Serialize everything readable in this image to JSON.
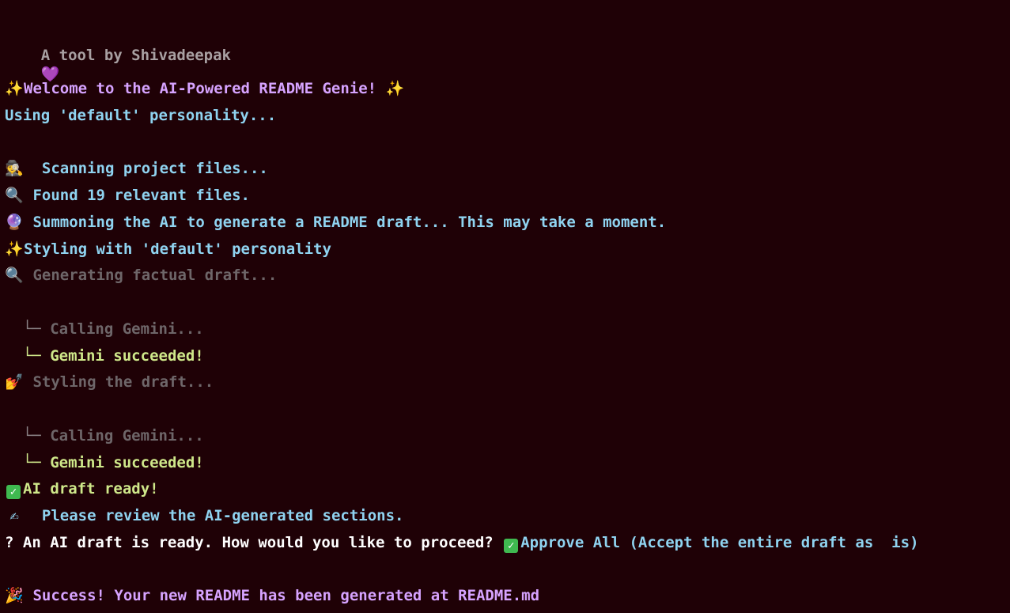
{
  "lines": {
    "tagline": "A tool by Shivadeepak",
    "heart_icon": "💜",
    "welcome": "Welcome to the AI-Powered README Genie!",
    "personality": "Using 'default' personality...",
    "scanning": "Scanning project files...",
    "found": "Found 19 relevant files.",
    "summoning": "Summoning the AI to generate a README draft... This may take a moment.",
    "styling_with": "Styling with 'default' personality",
    "generating": "Generating factual draft...",
    "calling1": "Calling Gemini...",
    "succeeded1": "Gemini succeeded!",
    "styling_draft": "Styling the draft...",
    "calling2": "Calling Gemini...",
    "succeeded2": "Gemini succeeded!",
    "draft_ready": "AI draft ready!",
    "review": "Please review the AI-generated sections.",
    "question_mark": "?",
    "question": "An AI draft is ready. How would you like to proceed?",
    "answer": "Approve All (Accept the entire draft as  is)",
    "success": "Success! Your new README has been generated at README.md"
  },
  "icons": {
    "sparkles": "✨",
    "sparkle_small": "✨",
    "detective": "🕵",
    "magnifier": "🔍",
    "crystal_ball": "🔮",
    "nail_polish": "💅",
    "check": "✓",
    "writing_hand": "✍",
    "party": "🎉",
    "tree_branch": "└─",
    "tree_end": "└─"
  }
}
